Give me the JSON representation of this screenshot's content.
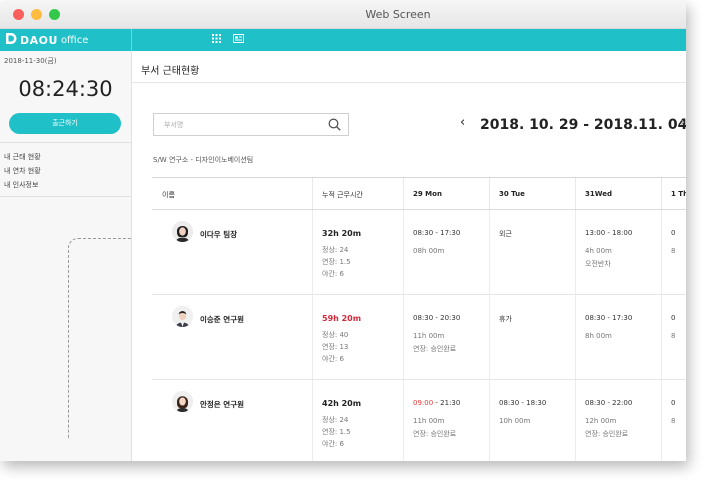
{
  "window": {
    "title": "Web Screen"
  },
  "topbar": {
    "logo_brand": "DAOU",
    "logo_sub": "office",
    "grid_icon": "grid-icon",
    "card_icon": "card-icon",
    "color": "#1fc0c8"
  },
  "sidebar": {
    "date": "2018-11-30(금)",
    "clock": "08:24:30",
    "clock_in_button": "출근하기",
    "links": [
      "내 근태 현황",
      "내 연차 현황",
      "내 인사정보"
    ]
  },
  "main": {
    "title": "부서 근태현황",
    "search_placeholder": "부서명",
    "week_prev": "‹",
    "week_range": "2018. 10. 29 - 2018.11. 04",
    "week_next": "›",
    "dept_path": "S/W 연구소 - 디자인이노베이션팀"
  },
  "table": {
    "headers": [
      "이름",
      "누적 근무시간",
      "29 Mon",
      "30 Tue",
      "31Wed",
      "1 Th"
    ],
    "rows": [
      {
        "name": "이다우 팀장",
        "total": "32h 20m",
        "total_red": false,
        "total_details": [
          "정상: 24",
          "연장: 1.5",
          "야간: 6"
        ],
        "days": [
          {
            "main": "08:30 - 17:30",
            "main_red_part": "",
            "lines": [
              "08h 00m"
            ]
          },
          {
            "main": "외근",
            "main_red_part": "",
            "lines": []
          },
          {
            "main": "13:00 - 18:00",
            "main_red_part": "",
            "lines": [
              "4h 00m",
              "오전반차"
            ]
          },
          {
            "main": "0",
            "main_red_part": "",
            "lines": [
              "8"
            ]
          }
        ]
      },
      {
        "name": "이승준 연구원",
        "total": "59h 20m",
        "total_red": true,
        "total_details": [
          "정상: 40",
          "연장: 13",
          "야간: 6"
        ],
        "days": [
          {
            "main": "08:30 - 20:30",
            "main_red_part": "",
            "lines": [
              "11h 00m",
              "연장: 승인완료"
            ]
          },
          {
            "main": "휴가",
            "main_red_part": "",
            "lines": []
          },
          {
            "main": "08:30 - 17:30",
            "main_red_part": "",
            "lines": [
              "8h 00m"
            ]
          },
          {
            "main": "0",
            "main_red_part": "",
            "lines": [
              "8"
            ]
          }
        ]
      },
      {
        "name": "안정은 연구원",
        "total": "42h 20m",
        "total_red": false,
        "total_details": [
          "정상: 24",
          "연장: 1.5",
          "야간: 6"
        ],
        "days": [
          {
            "main": " - 21:30",
            "main_red_part": "09:00",
            "lines": [
              "11h 00m",
              "연장: 승인완료"
            ]
          },
          {
            "main": "08:30 - 18:30",
            "main_red_part": "",
            "lines": [
              "10h 00m"
            ]
          },
          {
            "main": "08:30 - 22:00",
            "main_red_part": "",
            "lines": [
              "12h 00m",
              "연장: 승인완료"
            ]
          },
          {
            "main": "0",
            "main_red_part": "",
            "lines": [
              "8"
            ]
          }
        ]
      }
    ]
  },
  "colors": {
    "accent": "#1fc0c8",
    "overtime_red": "#d2283a"
  }
}
